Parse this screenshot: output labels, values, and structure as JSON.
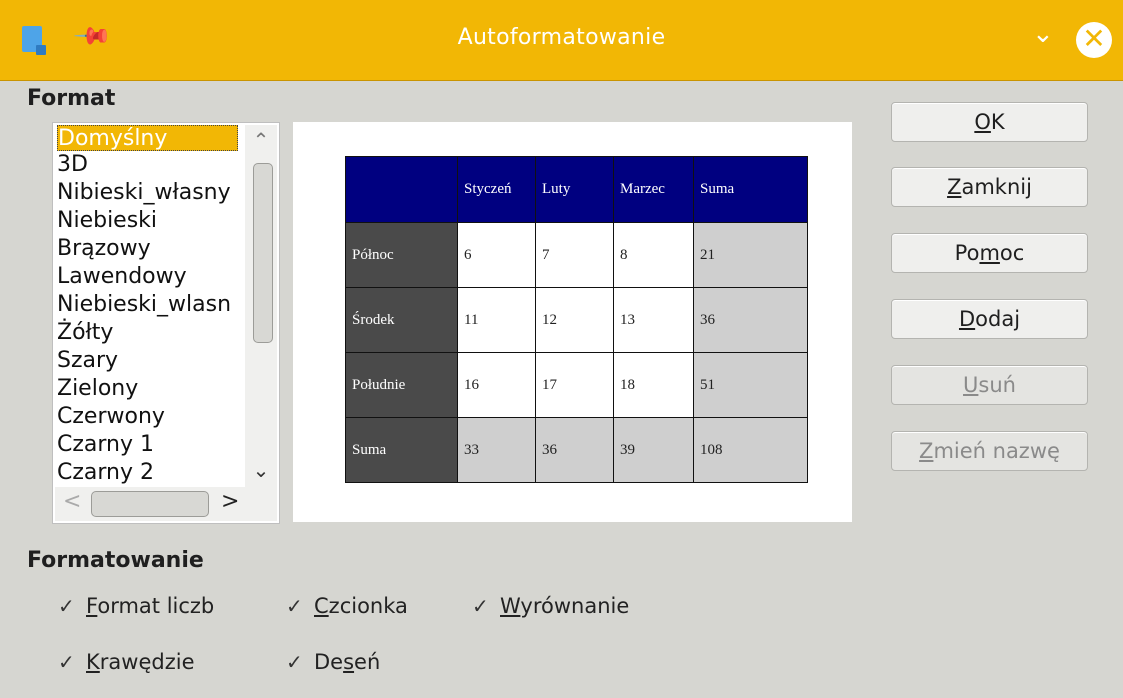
{
  "window": {
    "title": "Autoformatowanie",
    "accent": "#f2b705"
  },
  "format_section": {
    "label": "Format",
    "items": [
      "Domyślny",
      "3D",
      "Nibieski_własny",
      "Niebieski",
      "Brązowy",
      "Lawendowy",
      "Niebieski_wlasn",
      "Żółty",
      "Szary",
      "Zielony",
      "Czerwony",
      "Czarny 1",
      "Czarny 2"
    ],
    "selected": "Domyślny"
  },
  "preview": {
    "header": [
      "",
      "Styczeń",
      "Luty",
      "Marzec",
      "Suma"
    ],
    "rows": [
      {
        "label": "Północ",
        "values": [
          "6",
          "7",
          "8",
          "21"
        ]
      },
      {
        "label": "Środek",
        "values": [
          "11",
          "12",
          "13",
          "36"
        ]
      },
      {
        "label": "Południe",
        "values": [
          "16",
          "17",
          "18",
          "51"
        ]
      },
      {
        "label": "Suma",
        "values": [
          "33",
          "36",
          "39",
          "108"
        ]
      }
    ],
    "colors": {
      "header_bg": "#000080",
      "row_header_bg": "#4a4a4a",
      "sum_bg": "#cfcfcf"
    }
  },
  "buttons": {
    "ok": {
      "pre": "",
      "u": "O",
      "post": "K"
    },
    "close": {
      "pre": "",
      "u": "Z",
      "post": "amknij"
    },
    "help": {
      "pre": "Po",
      "u": "m",
      "post": "oc"
    },
    "add": {
      "pre": "",
      "u": "D",
      "post": "odaj"
    },
    "delete": {
      "pre": "",
      "u": "U",
      "post": "suń"
    },
    "rename": {
      "pre": "",
      "u": "Z",
      "post": "mień nazwę"
    }
  },
  "formatting_section": {
    "label": "Formatowanie",
    "options": {
      "number_format": {
        "u": "F",
        "post": "ormat liczb",
        "checked": true
      },
      "font": {
        "u": "C",
        "post": "zcionka",
        "checked": true
      },
      "alignment": {
        "u": "W",
        "post": "yrównanie",
        "checked": true
      },
      "borders": {
        "u": "K",
        "post": "rawędzie",
        "checked": true
      },
      "pattern": {
        "pre": "De",
        "u": "s",
        "post": "eń",
        "checked": true
      }
    },
    "check_glyph": "✓"
  }
}
